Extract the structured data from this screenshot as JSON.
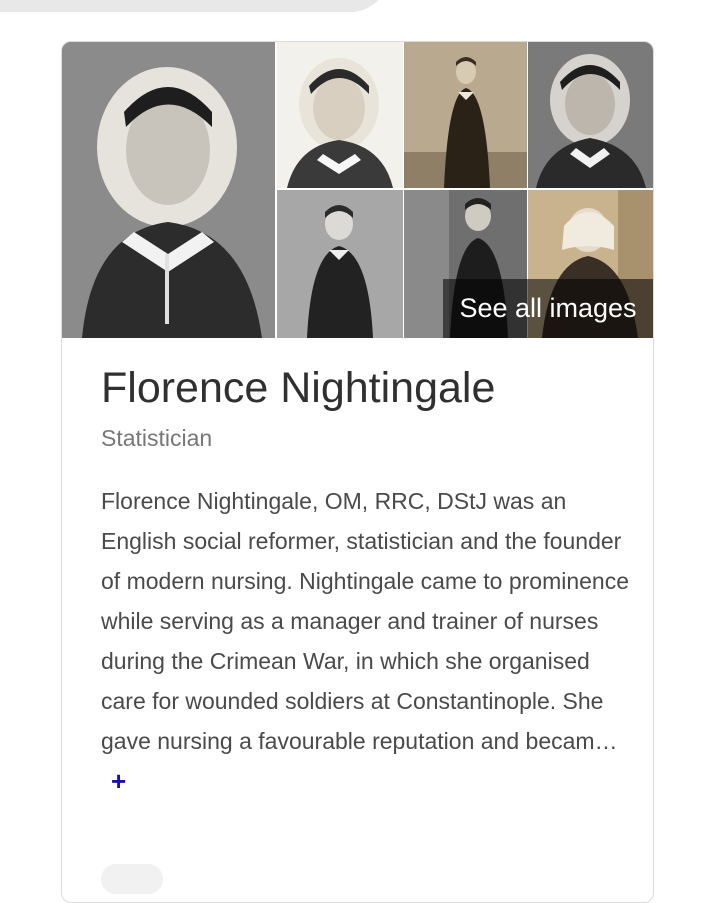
{
  "gallery": {
    "see_all_label": "See all images"
  },
  "entity": {
    "name": "Florence Nightingale",
    "subtitle": "Statistician",
    "description": "Florence Nightingale, OM, RRC, DStJ was an English social reformer, statistician and the founder of modern nursing. Nightingale came to prominence while serving as a manager and trainer of nurses during the Crimean War, in which she organised care for wounded soldiers at Constantinople. She gave nursing a favourable reputation and becam…",
    "more_glyph": "+"
  },
  "colors": {
    "link_blue": "#1a0dab",
    "title_text": "#303030",
    "subtitle_text": "#777777"
  }
}
